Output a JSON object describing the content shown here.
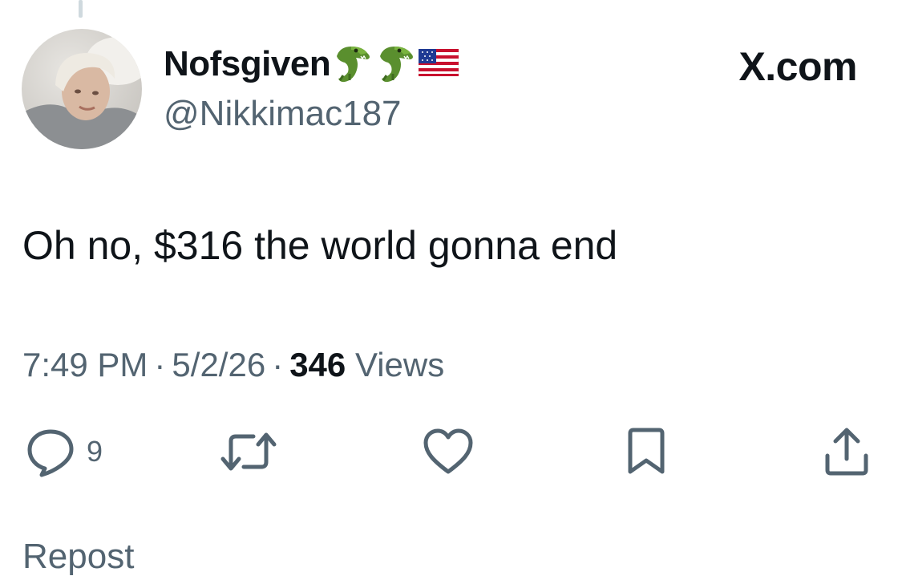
{
  "author": {
    "display_name": "Nofsgiven",
    "handle": "@Nikkimac187",
    "name_emojis": [
      "crocodile-icon",
      "crocodile-icon",
      "us-flag-icon"
    ]
  },
  "brand": {
    "label": "X.com"
  },
  "tweet": {
    "text": "Oh no, $316 the world gonna end",
    "time": "7:49 PM",
    "separator": "·",
    "date": "5/2/26",
    "views_count": "346",
    "views_label": "Views"
  },
  "actions": {
    "reply_count": "9",
    "icons": [
      "reply-icon",
      "retweet-icon",
      "like-icon",
      "bookmark-icon",
      "share-icon"
    ]
  },
  "footer": {
    "partial_label": "Repost"
  },
  "colors": {
    "text_primary": "#0f1419",
    "text_secondary": "#536471",
    "thread_line": "#cfd9de"
  }
}
